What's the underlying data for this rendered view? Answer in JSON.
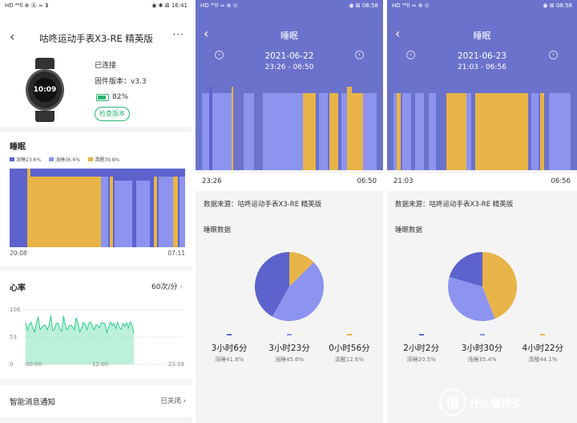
{
  "colors": {
    "deep": "#5c63cd",
    "light": "#8c94f0",
    "awake": "#e8b447",
    "green": "#2bb673",
    "hrfill": "#8fe6c0",
    "hrline": "#2ecb8a"
  },
  "p1": {
    "status": {
      "left": "HD ⁴⁶ll ⊕ Ⓐ ≈ 𝟭",
      "right": "◉ ✱ ⊠ 16:41"
    },
    "title": "咕咚运动手表X3-RE 精英版",
    "more": "···",
    "watch_time": "10:09",
    "connected": "已连接",
    "firmware": "固件版本：v3.3",
    "battery": "82%",
    "battery_level": 0.82,
    "check": "检查版本",
    "sleep_title": "睡眠",
    "legend": [
      {
        "label": "深睡23.6%",
        "color": "#5c63cd"
      },
      {
        "label": "浅睡36.6%",
        "color": "#8c94f0"
      },
      {
        "label": "清醒39.8%",
        "color": "#e8b447"
      }
    ],
    "start": "20:08",
    "end": "07:11",
    "hr_title": "心率",
    "hr_value": "60次/分",
    "hr_y": [
      "106",
      "53",
      "0"
    ],
    "hr_x": [
      "00:00",
      "12:00",
      "23:59"
    ],
    "notif_label": "智能消息通知",
    "notif_value": "已关闭"
  },
  "p2": {
    "status": {
      "left": "HD ⁴⁶ll ≈ ⊕ ⊙",
      "right": "◉ ⊠ 08:58"
    },
    "title": "睡眠",
    "date": "2021-06-22",
    "range": "23:26 - 06:50",
    "start": "23:26",
    "end": "06:50",
    "source": "数据来源：咕咚运动手表X3-RE 精英版",
    "data_title": "睡眠数据",
    "stats": [
      {
        "v": "3小时6分",
        "p": "深睡41.8%",
        "color": "#5c63cd"
      },
      {
        "v": "3小时23分",
        "p": "浅睡45.6%",
        "color": "#8c94f0"
      },
      {
        "v": "0小时56分",
        "p": "清醒12.6%",
        "color": "#e8b447"
      }
    ]
  },
  "p3": {
    "status": {
      "left": "HD ⁴⁶ll ≈ ⊕ ⊙",
      "right": "◉ ⊠ 08:58"
    },
    "title": "睡眠",
    "date": "2021-06-23",
    "range": "21:03 - 06:56",
    "start": "21:03",
    "end": "06:56",
    "source": "数据来源：咕咚运动手表X3-RE 精英版",
    "data_title": "睡眠数据",
    "stats": [
      {
        "v": "2小时2分",
        "p": "深睡20.5%",
        "color": "#5c63cd"
      },
      {
        "v": "3小时30分",
        "p": "浅睡35.4%",
        "color": "#8c94f0"
      },
      {
        "v": "4小时22分",
        "p": "清醒44.1%",
        "color": "#e8b447"
      }
    ]
  },
  "watermark": {
    "glyph": "值",
    "text": "什么值得买"
  },
  "chart_data": [
    {
      "type": "pie",
      "series": [
        {
          "values": [
            41.8,
            45.6,
            12.6
          ],
          "labels": [
            "深睡41.8%",
            "浅睡45.6%",
            "清醒12.6%"
          ]
        }
      ]
    },
    {
      "type": "pie",
      "series": [
        {
          "values": [
            20.5,
            35.4,
            44.1
          ],
          "labels": [
            "深睡20.5%",
            "浅睡35.4%",
            "清醒44.1%"
          ]
        }
      ]
    }
  ]
}
